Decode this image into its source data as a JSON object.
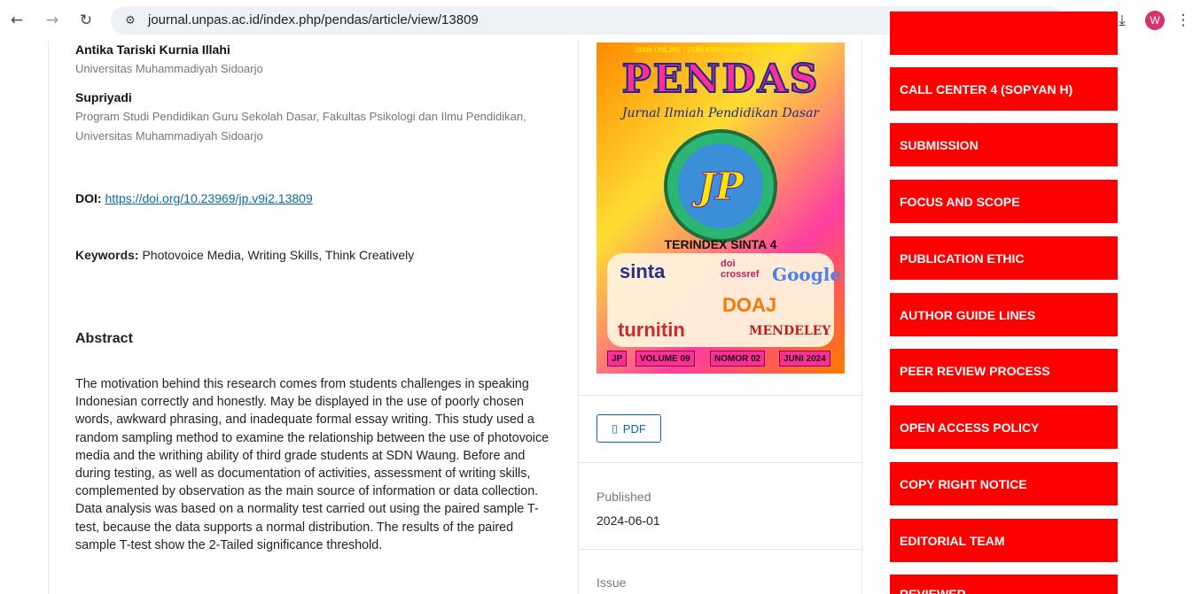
{
  "browser": {
    "url": "journal.unpas.ac.id/index.php/pendas/article/view/13809",
    "avatar_letter": "W"
  },
  "authors": [
    {
      "name": "Antika Tariski Kurnia Illahi",
      "affiliation": "Universitas Muhammadiyah Sidoarjo"
    },
    {
      "name": "Supriyadi",
      "affiliation": "Program Studi Pendidikan Guru Sekolah Dasar, Fakultas Psikologi dan Ilmu Pendidikan, Universitas Muhammadiyah Sidoarjo"
    }
  ],
  "doi": {
    "label": "DOI:",
    "link": "https://doi.org/10.23969/jp.v9i2.13809"
  },
  "keywords": {
    "label": "Keywords:",
    "value": "Photovoice Media, Writing Skills, Think Creatively"
  },
  "abstract": {
    "title": "Abstract",
    "text": "The motivation behind this research comes from students challenges in speaking Indonesian correctly and honestly. May be displayed in the use of poorly chosen words, awkward phrasing, and inadequate formal essay writing. This study used a random sampling method to examine the relationship between the use of photovoice media and the writhing ability of third grade students at SDN Waung. Before and during testing, as well as documentation of activities, assessment of writing skills, complemented by observation as the main source of information or data collection. Data analysis was based on a normality test carried out using the paired sample T-test, because the data supports a normal distribution. The results of the paired sample T-test show the 2-Tailed significance threshold."
  },
  "cover": {
    "issn": "ISSN ONLINE : 2548-6950  ISSN CETAK : 2477-2143",
    "masthead": "PENDAS",
    "subtitle": "Jurnal Ilmiah Pendidikan Dasar",
    "logo_text": "JP",
    "sinta": "TERINDEX SINTA 4",
    "badges": [
      "sinta",
      "doi crossref",
      "Google",
      "DOAJ",
      "turnitin",
      "MENDELEY"
    ],
    "footer": [
      "JP",
      "VOLUME 09",
      "NOMOR 02",
      "JUNI 2024"
    ]
  },
  "galley": {
    "pdf_label": "PDF"
  },
  "published": {
    "label": "Published",
    "value": "2024-06-01"
  },
  "issue": {
    "label": "Issue"
  },
  "menu": [
    "CALL CENTER 4 (SOPYAN H)",
    "SUBMISSION",
    "FOCUS AND SCOPE",
    "PUBLICATION ETHIC",
    "AUTHOR GUIDE LINES",
    "PEER REVIEW PROCESS",
    "OPEN ACCESS POLICY",
    "COPY RIGHT NOTICE",
    "EDITORIAL TEAM",
    "REVIEWER"
  ],
  "colors": {
    "menu_red": "#ff0000",
    "link_blue": "#0b6aa6"
  }
}
